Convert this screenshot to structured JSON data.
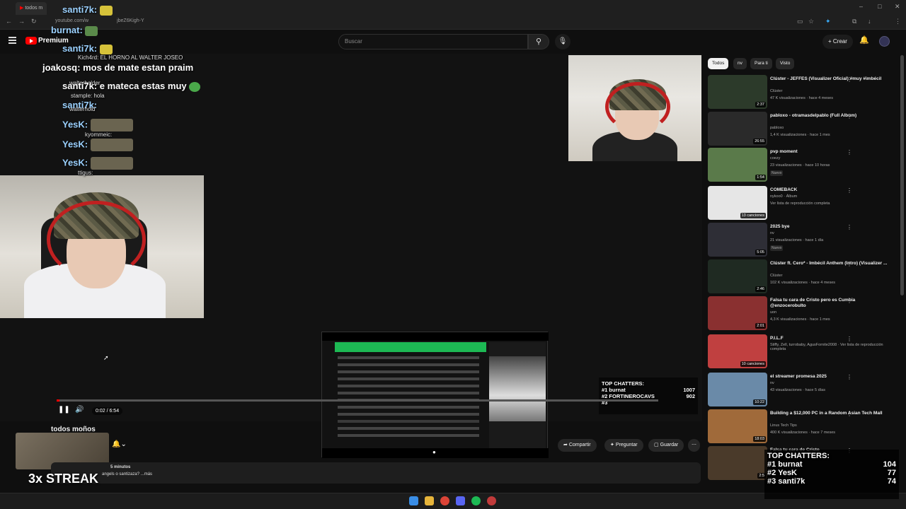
{
  "browser": {
    "tab_title": "todos m",
    "url": "youtube.com/w",
    "url_tail": "jbeZ6Kigh-Y"
  },
  "header": {
    "brand": "Premium",
    "search_placeholder": "Buscar",
    "create_label": "Crear"
  },
  "chat_overlay": [
    {
      "user": "santi7k:",
      "text": ""
    },
    {
      "user": "burnat:",
      "text": ""
    },
    {
      "user": "santi7k:",
      "text": ""
    },
    {
      "user": "Kich4rd:",
      "text": "EL HORNO AL WALTER JOSEO"
    },
    {
      "user": "joakosq:",
      "text": "mos de mate estan praim"
    },
    {
      "user": "walterholder",
      "text": ""
    },
    {
      "user": "santi7k:",
      "text": "e mateca estas muy"
    },
    {
      "user": "stample:",
      "text": "hola"
    },
    {
      "user": "santi7k:",
      "text": ""
    },
    {
      "user": "walterhold",
      "text": ""
    },
    {
      "user": "YesK:",
      "text": ""
    },
    {
      "user": "kyommeic:",
      "text": ""
    },
    {
      "user": "YesK:",
      "text": ""
    },
    {
      "user": "YesK:",
      "text": ""
    },
    {
      "user": "ttigus:",
      "text": ""
    }
  ],
  "player": {
    "current_time": "0:02 / 6:54",
    "progress": 0.005
  },
  "top_chatters_small": {
    "title": "TOP CHATTERS:",
    "rows": [
      {
        "rank": "#1 burnat",
        "count": "1007"
      },
      {
        "rank": "#2 FORTINEROCAVS",
        "count": "902"
      },
      {
        "rank": "#3",
        "count": ""
      }
    ]
  },
  "top_chatters_big": {
    "title": "TOP CHATTERS:",
    "rows": [
      {
        "rank": "#1 burnat",
        "count": "104"
      },
      {
        "rank": "#2 YesK",
        "count": "77"
      },
      {
        "rank": "#3 santi7k",
        "count": "74"
      }
    ]
  },
  "video": {
    "title": "todos moños",
    "share_label": "Compartir",
    "ask_label": "Preguntar",
    "save_label": "Guardar",
    "upload_age": "5 minutos",
    "description": "angels o santizaza? ...más",
    "streak": "3x STREAK"
  },
  "chips": [
    "Todos",
    "nv",
    "Para ti",
    "Visto"
  ],
  "recommendations": [
    {
      "title": "Clúster - JEFFES (Visualizer Oficial) #muy #imbécil",
      "channel": "Clúster",
      "meta": "47 K visualizaciones · hace 4 meses",
      "duration": "2:37",
      "color": "#2c3a2a",
      "badge": ""
    },
    {
      "title": "pabloxo - otramasdelpablo (Full Album)",
      "channel": "pabloxo",
      "meta": "1,4 K visualizaciones · hace 1 mes",
      "duration": "26:55",
      "color": "#2a2a2a",
      "badge": ""
    },
    {
      "title": "pvp moment",
      "channel": "coezy",
      "meta": "23 visualizaciones · hace 10 horas",
      "duration": "1:54",
      "color": "#5a7a4a",
      "badge": "Nuevo"
    },
    {
      "title": "COMEBACK",
      "channel": "nykoo0 · Álbum",
      "meta": "Ver lista de reproducción completa",
      "duration": "13 canciones",
      "color": "#e6e6e6",
      "badge": ""
    },
    {
      "title": "2025 bye",
      "channel": "nv",
      "meta": "21 visualizaciones · hace 1 día",
      "duration": "5:05",
      "color": "#2e2e36",
      "badge": "Nuevo"
    },
    {
      "title": "Clúster ft. Cero* - Imbécil Anthem (Intro) (Visualizer ...",
      "channel": "Clúster",
      "meta": "102 K visualizaciones · hace 4 meses",
      "duration": "2:46",
      "color": "#1f2a22",
      "badge": ""
    },
    {
      "title": "Falsa tu cara de Cristo pero es Cumbia @enzocerobulto",
      "channel": "uon",
      "meta": "4,3 K visualizaciones · hace 1 mes",
      "duration": "2:01",
      "color": "#8a3030",
      "badge": ""
    },
    {
      "title": "P.I.L.F",
      "channel": "Stiffy, Zell, turrobaby, AgusFornite2008 · Ver lista de reproducción completa",
      "meta": "",
      "duration": "10 canciones",
      "color": "#c04040",
      "badge": ""
    },
    {
      "title": "el streamer promesa 2025",
      "channel": "nv",
      "meta": "43 visualizaciones · hace 5 días",
      "duration": "10:22",
      "color": "#6a8aa8",
      "badge": ""
    },
    {
      "title": "Building a $12,000 PC in a Random Asian Tech Mall",
      "channel": "Linus Tech Tips",
      "meta": "400 K visualizaciones · hace 7 meses",
      "duration": "18:03",
      "color": "#a06a3a",
      "badge": ""
    },
    {
      "title": "Falsa tu cara de Cristo",
      "channel": "",
      "meta": "",
      "duration": "2:5",
      "color": "#4a3a2a",
      "badge": ""
    }
  ]
}
